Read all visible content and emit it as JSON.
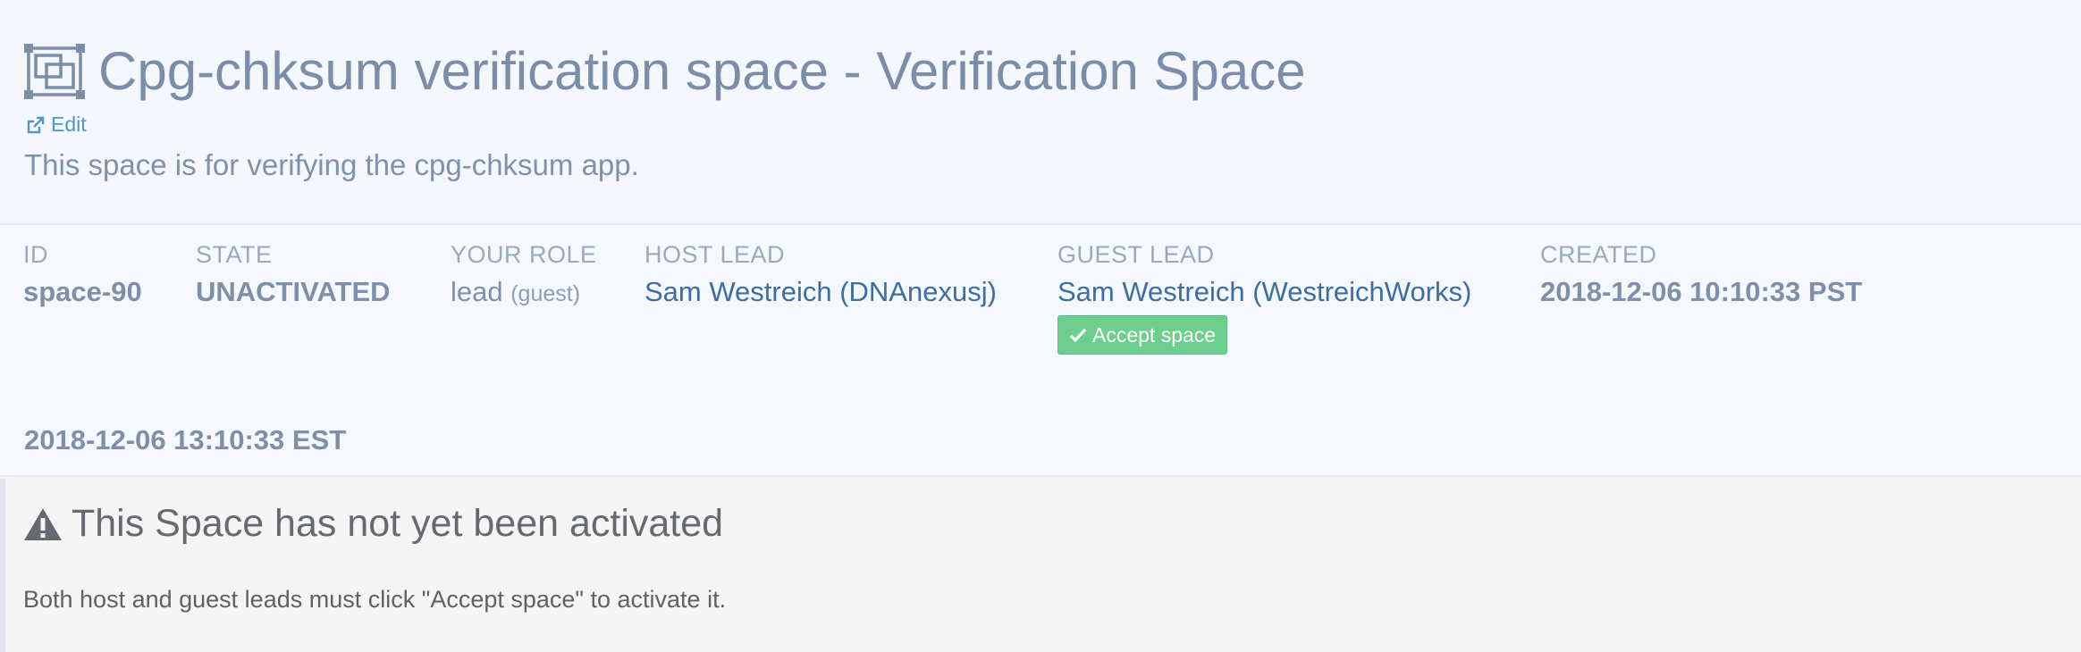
{
  "header": {
    "title": "Cpg-chksum verification space - Verification Space",
    "edit_label": "Edit",
    "description": "This space is for verifying the cpg-chksum app."
  },
  "meta": {
    "id": {
      "label": "ID",
      "value": "space-90"
    },
    "state": {
      "label": "STATE",
      "value": "UNACTIVATED"
    },
    "role": {
      "label": "YOUR ROLE",
      "value": "lead",
      "sub": "(guest)"
    },
    "host_lead": {
      "label": "HOST LEAD",
      "value": "Sam Westreich (DNAnexusj)"
    },
    "guest_lead": {
      "label": "GUEST LEAD",
      "value": "Sam Westreich (WestreichWorks)",
      "accept_label": "Accept space"
    },
    "created": {
      "label": "CREATED",
      "value": "2018-12-06 10:10:33 PST"
    },
    "created_local": "2018-12-06 13:10:33 EST"
  },
  "alert": {
    "title": "This Space has not yet been activated",
    "body": "Both host and guest leads must click \"Accept space\" to activate it."
  },
  "icons": {
    "space": "spaces-icon",
    "edit": "external-link-icon",
    "accept": "checkmark-icon",
    "warning": "warning-triangle-icon"
  },
  "colors": {
    "link": "#3c6da5",
    "accept_button": "#6ccf8f",
    "text_muted": "#7a8eab"
  }
}
